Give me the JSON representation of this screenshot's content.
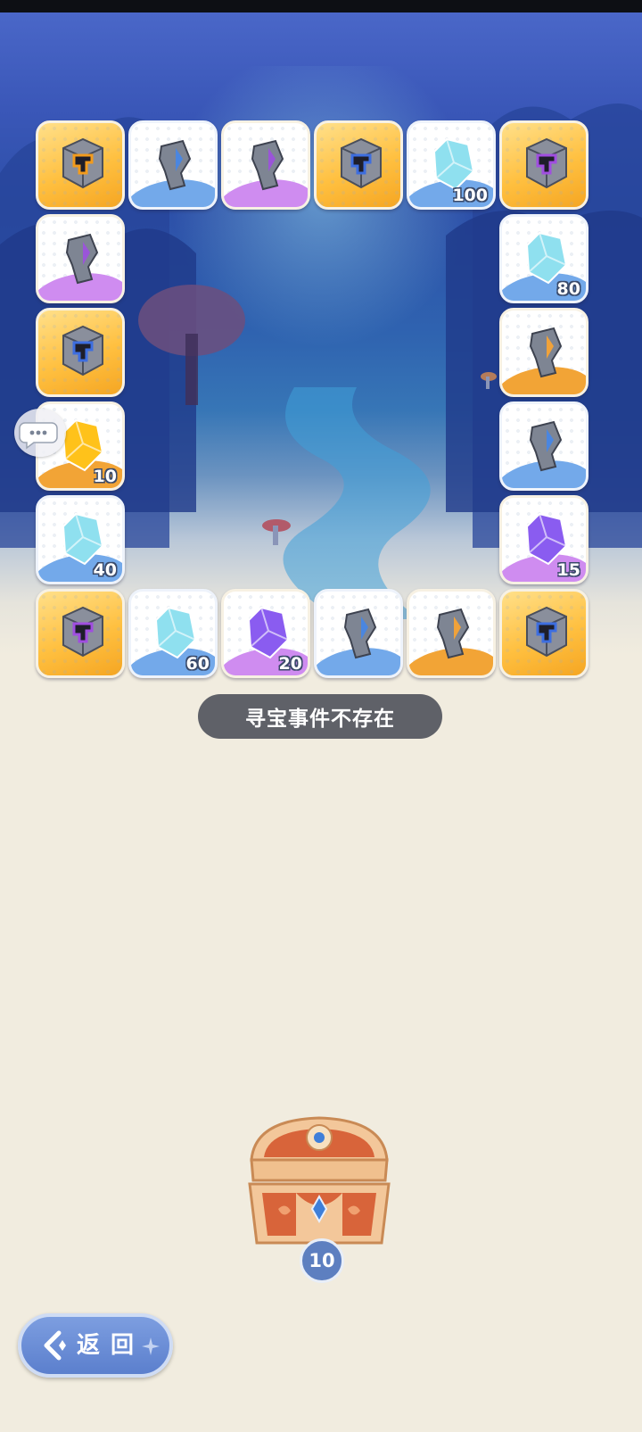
{
  "board": {
    "tiles": [
      {
        "id": "t1",
        "rarity": "gold",
        "icon": "purple-cube-icon",
        "accent": "#f29b1d",
        "qty": ""
      },
      {
        "id": "t2",
        "rarity": "blue",
        "icon": "blue-shard-stone-icon",
        "accent": "#4a86e0",
        "qty": ""
      },
      {
        "id": "t3",
        "rarity": "purple",
        "icon": "purple-shard-stone-icon",
        "accent": "#9a55d8",
        "qty": ""
      },
      {
        "id": "t4",
        "rarity": "gold",
        "icon": "blue-cube-icon",
        "accent": "#3d6ee0",
        "qty": ""
      },
      {
        "id": "t5",
        "rarity": "blue",
        "icon": "cyan-crystal-icon",
        "accent": "#8fe0ef",
        "qty": "100"
      },
      {
        "id": "t6",
        "rarity": "gold",
        "icon": "purple-cube-icon",
        "accent": "#a04ee0",
        "qty": ""
      },
      {
        "id": "t7",
        "rarity": "purple",
        "icon": "purple-shard-stone-icon",
        "accent": "#9a55d8",
        "qty": ""
      },
      {
        "id": "t8",
        "rarity": "blue",
        "icon": "cyan-crystal-icon",
        "accent": "#8fe0ef",
        "qty": "80"
      },
      {
        "id": "t9",
        "rarity": "gold",
        "icon": "blue-cube-icon",
        "accent": "#3d6ee0",
        "qty": ""
      },
      {
        "id": "t10",
        "rarity": "orange",
        "icon": "orange-shard-stone-icon",
        "accent": "#f0a23a",
        "qty": ""
      },
      {
        "id": "t11",
        "rarity": "orange",
        "icon": "gold-crystal-icon",
        "accent": "#ffc21a",
        "qty": "10"
      },
      {
        "id": "t12",
        "rarity": "blue",
        "icon": "blue-shard-stone-icon",
        "accent": "#4a86e0",
        "qty": ""
      },
      {
        "id": "t13",
        "rarity": "blue",
        "icon": "cyan-crystal-icon",
        "accent": "#8fe0ef",
        "qty": "40"
      },
      {
        "id": "t14",
        "rarity": "purple",
        "icon": "violet-crystal-icon",
        "accent": "#8a5cf0",
        "qty": "15"
      },
      {
        "id": "t15",
        "rarity": "gold",
        "icon": "purple-cube-icon",
        "accent": "#a04ee0",
        "qty": ""
      },
      {
        "id": "t16",
        "rarity": "blue",
        "icon": "cyan-crystal-icon",
        "accent": "#8fe0ef",
        "qty": "60"
      },
      {
        "id": "t17",
        "rarity": "purple",
        "icon": "violet-crystal-icon",
        "accent": "#8a5cf0",
        "qty": "20"
      },
      {
        "id": "t18",
        "rarity": "blue",
        "icon": "blue-shard-stone-icon",
        "accent": "#4a86e0",
        "qty": ""
      },
      {
        "id": "t19",
        "rarity": "orange",
        "icon": "orange-shard-stone-icon",
        "accent": "#f0a23a",
        "qty": ""
      },
      {
        "id": "t20",
        "rarity": "gold",
        "icon": "blue-cube-icon",
        "accent": "#3d6ee0",
        "qty": ""
      }
    ]
  },
  "toast": {
    "text": "寻宝事件不存在"
  },
  "chat": {
    "icon": "chat-bubble-icon"
  },
  "chest": {
    "icon": "treasure-chest-icon",
    "count": "10"
  },
  "back_button": {
    "label": "返回",
    "icon": "back-arrow-icon"
  },
  "colors": {
    "toast_bg": "#5f6168",
    "back_button": "#6a8ed6",
    "page_bg": "#f1ecdf"
  }
}
